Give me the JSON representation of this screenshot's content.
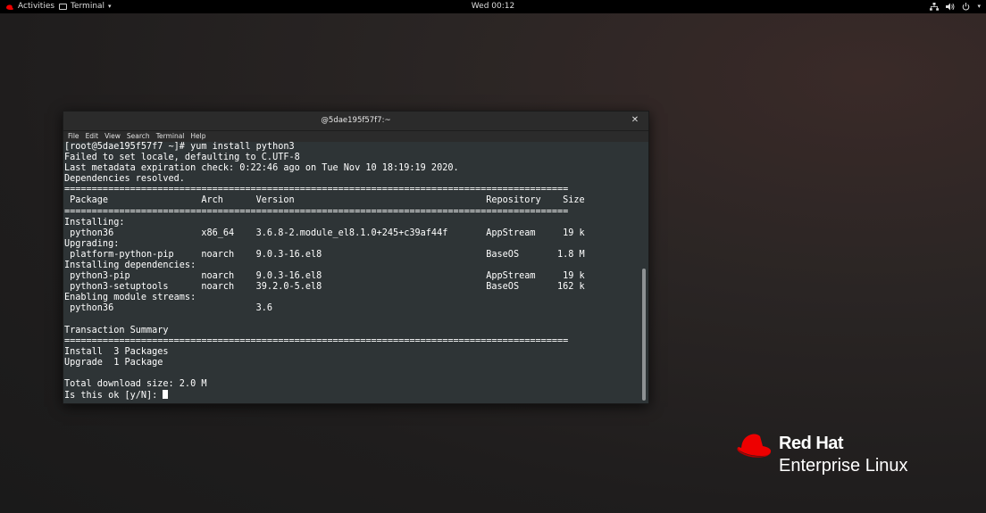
{
  "topbar": {
    "activities_label": "Activities",
    "app_menu_label": "Terminal",
    "clock": "Wed 00:12",
    "icons": [
      "network-icon",
      "volume-icon",
      "power-icon",
      "chevron-down-icon"
    ]
  },
  "window": {
    "title": "@5dae195f57f7:~",
    "menu": [
      "File",
      "Edit",
      "View",
      "Search",
      "Terminal",
      "Help"
    ]
  },
  "terminal": {
    "lines": [
      "[root@5dae195f57f7 ~]# yum install python3",
      "Failed to set locale, defaulting to C.UTF-8",
      "Last metadata expiration check: 0:22:46 ago on Tue Nov 10 18:19:19 2020.",
      "Dependencies resolved.",
      "============================================================================================",
      " Package                 Arch      Version                                   Repository    Size",
      "============================================================================================",
      "Installing:",
      " python36                x86_64    3.6.8-2.module_el8.1.0+245+c39af44f       AppStream     19 k",
      "Upgrading:",
      " platform-python-pip     noarch    9.0.3-16.el8                              BaseOS       1.8 M",
      "Installing dependencies:",
      " python3-pip             noarch    9.0.3-16.el8                              AppStream     19 k",
      " python3-setuptools      noarch    39.2.0-5.el8                              BaseOS       162 k",
      "Enabling module streams:",
      " python36                          3.6",
      "",
      "Transaction Summary",
      "============================================================================================",
      "Install  3 Packages",
      "Upgrade  1 Package",
      "",
      "Total download size: 2.0 M"
    ],
    "prompt": "Is this ok [y/N]: "
  },
  "branding": {
    "company": "Red Hat",
    "product": "Enterprise Linux",
    "accent": "#ee0000"
  }
}
